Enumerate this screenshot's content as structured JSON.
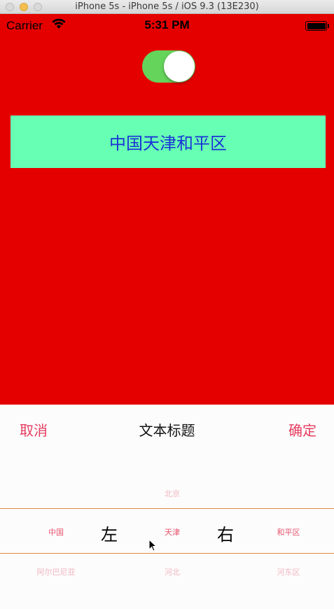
{
  "window": {
    "title": "iPhone 5s - iPhone 5s / iOS 9.3 (13E230)"
  },
  "status_bar": {
    "carrier": "Carrier",
    "time": "5:31 PM",
    "wifi_icon": "wifi-icon",
    "battery_icon": "battery-icon"
  },
  "toggle": {
    "state": "on",
    "color": "#65d45b"
  },
  "address": {
    "text": "中国天津和平区",
    "background": "#66ffb3",
    "text_color": "#1a33d6"
  },
  "picker": {
    "cancel_label": "取消",
    "title": "文本标题",
    "confirm_label": "确定",
    "columns": [
      {
        "above": "",
        "selected": "中国",
        "below": "阿尔巴尼亚"
      },
      {
        "above": "北京",
        "selected": "天津",
        "below": "河北"
      },
      {
        "above": "",
        "selected": "和平区",
        "below": "河东区"
      }
    ],
    "left_label": "左",
    "right_label": "右",
    "accent_color": "#e63c5f",
    "selection_line_color": "#e28a3a"
  },
  "colors": {
    "background": "#e50000"
  }
}
